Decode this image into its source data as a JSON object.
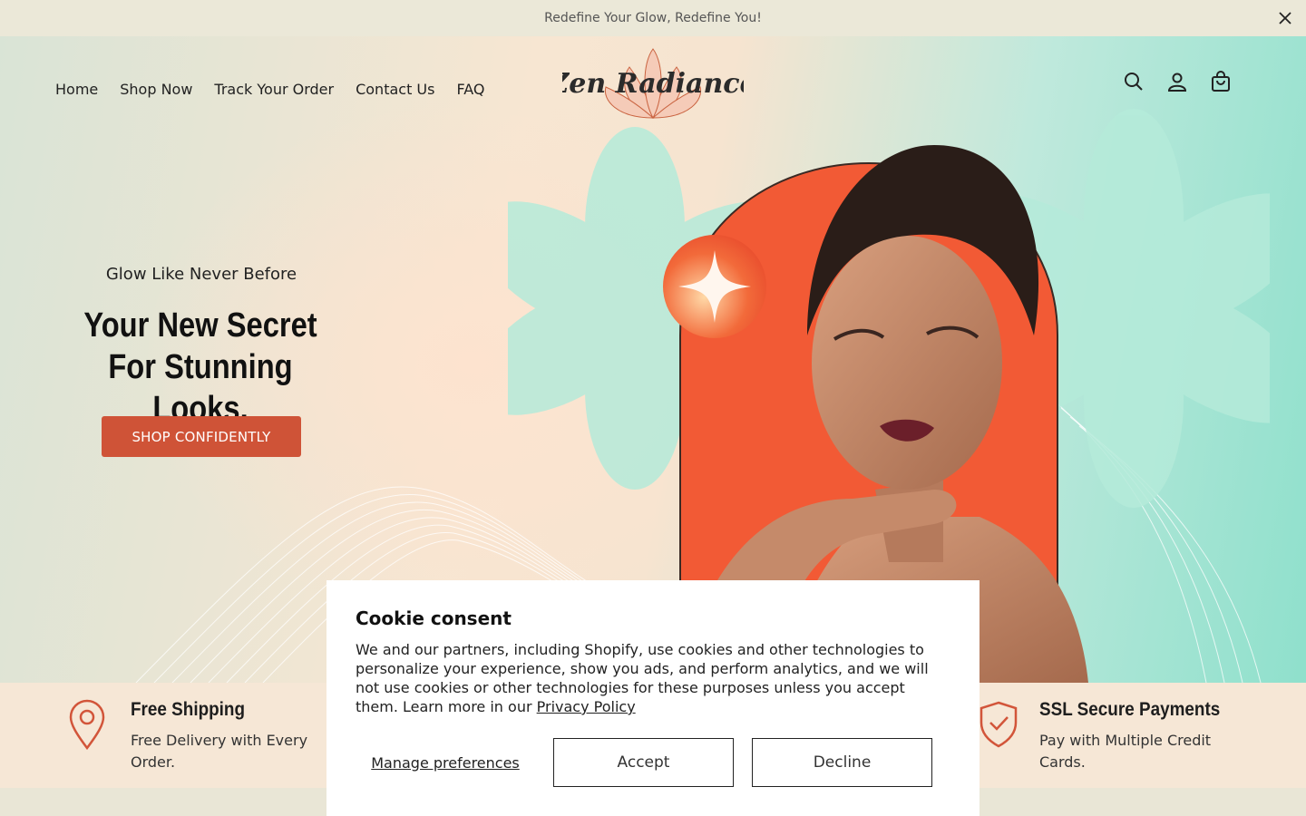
{
  "announcement": {
    "text": "Redefine Your Glow, Redefine You!",
    "close_icon": "close-icon"
  },
  "nav": {
    "items": [
      "Home",
      "Shop Now",
      "Track Your Order",
      "Contact Us",
      "FAQ"
    ]
  },
  "logo": {
    "text": "Zen Radiance"
  },
  "header_icons": [
    "search-icon",
    "account-icon",
    "cart-icon"
  ],
  "hero": {
    "eyebrow": "Glow Like Never Before",
    "headline_line1": "Your New Secret",
    "headline_line2": "For Stunning Looks.",
    "cta_label": "SHOP CONFIDENTLY"
  },
  "features": [
    {
      "icon": "map-pin-icon",
      "title": "Free Shipping",
      "description": "Free Delivery with Every Order."
    },
    {
      "icon": "shield-check-icon",
      "title": "SSL Secure Payments",
      "description": "Pay with Multiple Credit Cards."
    }
  ],
  "cookie": {
    "title": "Cookie consent",
    "body": "We and our partners, including Shopify, use cookies and other technologies to personalize your experience, show you ads, and perform analytics, and we will not use cookies or other technologies for these purposes unless you accept them. Learn more in our ",
    "link_label": "Privacy Policy",
    "manage_label": "Manage preferences",
    "accept_label": "Accept",
    "decline_label": "Decline"
  },
  "colors": {
    "accent": "#cf5337",
    "mint": "#8fe0cc",
    "peach": "#f6e7d6",
    "arch": "#f25a35"
  }
}
